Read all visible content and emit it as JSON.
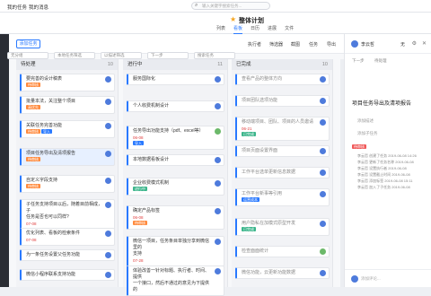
{
  "topbar": {
    "nav1": "我的任务",
    "nav2": "我的消息",
    "search_placeholder": "输入关键字搜索任务..."
  },
  "header": {
    "title": "整体计划",
    "tabs": [
      "列表",
      "看板",
      "日历",
      "进展",
      "文件"
    ],
    "active_tab": "看板"
  },
  "toolbar": {
    "add_task": "添加任务",
    "items": [
      "执行者",
      "筛选器",
      "截图",
      "任务",
      "导出"
    ]
  },
  "filters": [
    "无分组",
    "本地任务筛选",
    "以描述筛选",
    "下一步",
    "搜索任务"
  ],
  "columns": [
    {
      "name": "待处理",
      "count": "10"
    },
    {
      "name": "进行中",
      "count": "11"
    },
    {
      "name": "已完成",
      "count": "10"
    }
  ],
  "cards": {
    "c1": [
      "要完善的设计稿表"
    ],
    "c2": [
      "批量本法，关注整个项目"
    ],
    "c3": [
      "关联任务完善功能"
    ],
    "c4": [
      "项目任务导出及清项报告"
    ],
    "c5": [
      "自定义字段支持"
    ],
    "c6": [
      "子任务支持项目以后，随着目前相成，子",
      "任务是否也可以同样?"
    ],
    "c7": [
      "优化列表、看板的检索条件"
    ],
    "c8": [
      "为一条任务设置父任务功能"
    ],
    "c9": [
      "微信小程序联系支持功能"
    ],
    "m1": [
      "服务国际化"
    ],
    "m2": [
      "个人收费机制设计"
    ],
    "m3": [
      "任务导出功能支持（pdf、excel等）"
    ],
    "m4": [
      "本地数据看板设计"
    ],
    "m5": [
      "企业收费模式机制"
    ],
    "m6": [
      "确定产品标签"
    ],
    "m7": [
      "微信一项目，任务条目单独分享到微信里的",
      "支持"
    ],
    "m8": [
      "体验改善一针对标题、执行者、时间、提供",
      "一个接口，然后不通过的意见为下提供的"
    ],
    "d1": [
      "查看产品的整体方向"
    ],
    "d2": [
      "项目团队选项功能"
    ],
    "d3": [
      "移动端项目、团队、项目的人员邀请"
    ],
    "d4": [
      "项目页面设置界面"
    ],
    "d5": [
      "工作平台选单更新信息数据"
    ],
    "d6": [
      "工作平台新事等引用"
    ],
    "d7": [
      "用户隐私在加模式原型开发"
    ],
    "d8": [
      "检查面面统计"
    ],
    "d9": [
      "微信功能，云更新功能数据"
    ]
  },
  "tags": {
    "pending": "待审核",
    "high": "高优先",
    "done": "已完成",
    "doing": "进行中",
    "import": "导入",
    "cost": "运营成本"
  },
  "dates": {
    "d0708": "07-08",
    "d0608": "06-08",
    "d0728": "07-28",
    "d0621": "06-21"
  },
  "panel": {
    "owner": "李云哲",
    "none": "无",
    "step1": "下一步",
    "step2": "待处理",
    "title": "项目任务导出及清项报告",
    "desc_label": "添加描述",
    "add_subtask": "添加子任务",
    "tag": "待审核",
    "history": [
      "李云哲 创建了任务 2019-06-08 14:26",
      "李云哲 更新了任务名称 2019-06-08",
      "李云哲 设置执行者 2019-06-08",
      "李云哲 设置截止时间 2019-06-08",
      "李云哲 添加标签 2019-06-08 15:11",
      "李云哲 加入了子任务 2019-06-08"
    ],
    "comment_placeholder": "添加评论..."
  },
  "colors": {
    "accent": "#2979ff",
    "star": "#f5a623",
    "panel_border": "#e3e5ea"
  }
}
